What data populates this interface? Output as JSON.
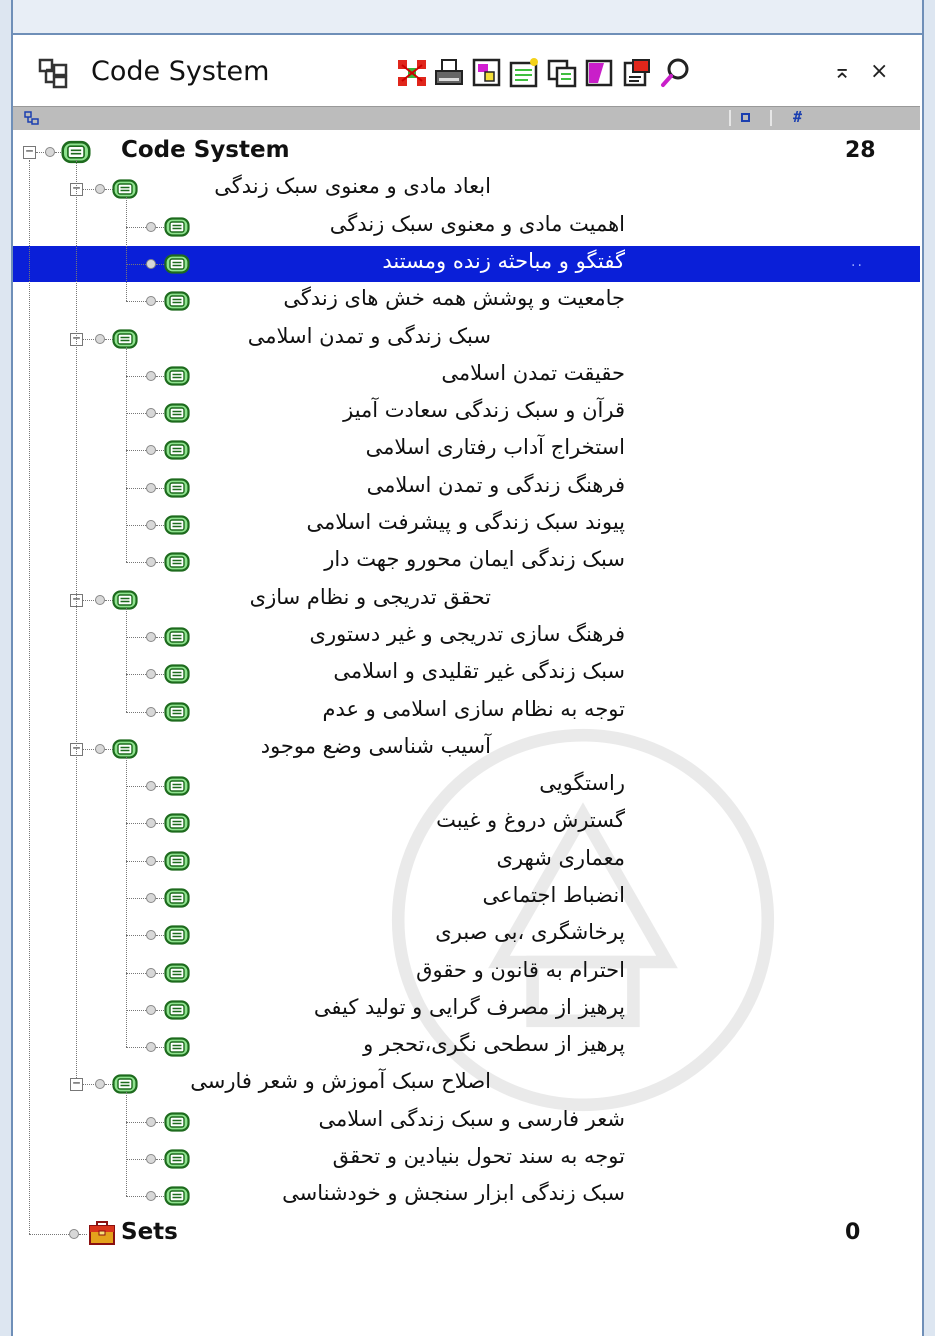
{
  "panel": {
    "title": "Code System",
    "icons": {
      "title": "code-system-icon",
      "toolbar": [
        "activate-all-codes-icon",
        "print-icon",
        "export-icon",
        "new-code-icon",
        "code-frequency-icon",
        "code-favorites-icon",
        "code-matrix-icon",
        "search-icon"
      ],
      "window": [
        "minimize-panel-icon",
        "close-panel-icon"
      ]
    },
    "window_controls": {
      "minimize": "⌅",
      "close": "×"
    }
  },
  "column_header": {
    "hash": "#"
  },
  "tree": {
    "root": {
      "label": "Code System",
      "count": "28"
    },
    "groups": [
      {
        "label": "ابعاد مادی و معنوی سبک زندگی",
        "children": [
          {
            "label": "اهمیت مادی و معنوی سبک زندگی"
          },
          {
            "label": "گفتگو و مباحثه زنده ومستند",
            "selected": true,
            "trailing": ".."
          },
          {
            "label": "جامعیت و پوشش همه خش های زندگی"
          }
        ]
      },
      {
        "label": "سبک زندگی و تمدن اسلامی",
        "children": [
          {
            "label": "حقیقت تمدن اسلامی"
          },
          {
            "label": "قرآن و سبک زندگی سعادت آمیز"
          },
          {
            "label": "استخراج آداب رفتاری اسلامی"
          },
          {
            "label": "فرهنگ زندگی و تمدن اسلامی"
          },
          {
            "label": "پیوند سبک زندگی و پیشرفت اسلامی"
          },
          {
            "label": "سبک زندگی ایمان محورو جهت دار"
          }
        ]
      },
      {
        "label": "تحقق تدریجی و نظام سازی",
        "children": [
          {
            "label": "فرهنگ سازی تدریجی و غیر دستوری"
          },
          {
            "label": "سبک زندگی غیر تقلیدی و اسلامی"
          },
          {
            "label": "توجه به نظام سازی اسلامی و عدم"
          }
        ]
      },
      {
        "label": "آسیب شناسی وضع موجود",
        "children": [
          {
            "label": "راستگویی"
          },
          {
            "label": "گسترش دروغ و غیبت"
          },
          {
            "label": "معماری شهری"
          },
          {
            "label": "انضباط اجتماعی"
          },
          {
            "label": "پرخاشگری ،بی صبری"
          },
          {
            "label": "احترام به قانون و حقوق"
          },
          {
            "label": "پرهیز از مصرف گرایی و تولید کیفی"
          },
          {
            "label": "پرهیز از سطحی نگری،تحجر و"
          }
        ]
      },
      {
        "label": "اصلاح سبک آموزش و شعر فارسی",
        "children": [
          {
            "label": "شعر فارسی و سبک زندگی اسلامی"
          },
          {
            "label": "توجه به سند تحول بنیادین و تحقق"
          },
          {
            "label": "سبک زندگی ابزار سنجش و خودشناسی"
          }
        ]
      }
    ],
    "sets": {
      "label": "Sets",
      "count": "0"
    }
  },
  "colors": {
    "selection": "#0a1fd8",
    "code_icon_green": "#3fbf3f",
    "header_strip": "#bcbcbc",
    "frame": "#dde6f1"
  }
}
